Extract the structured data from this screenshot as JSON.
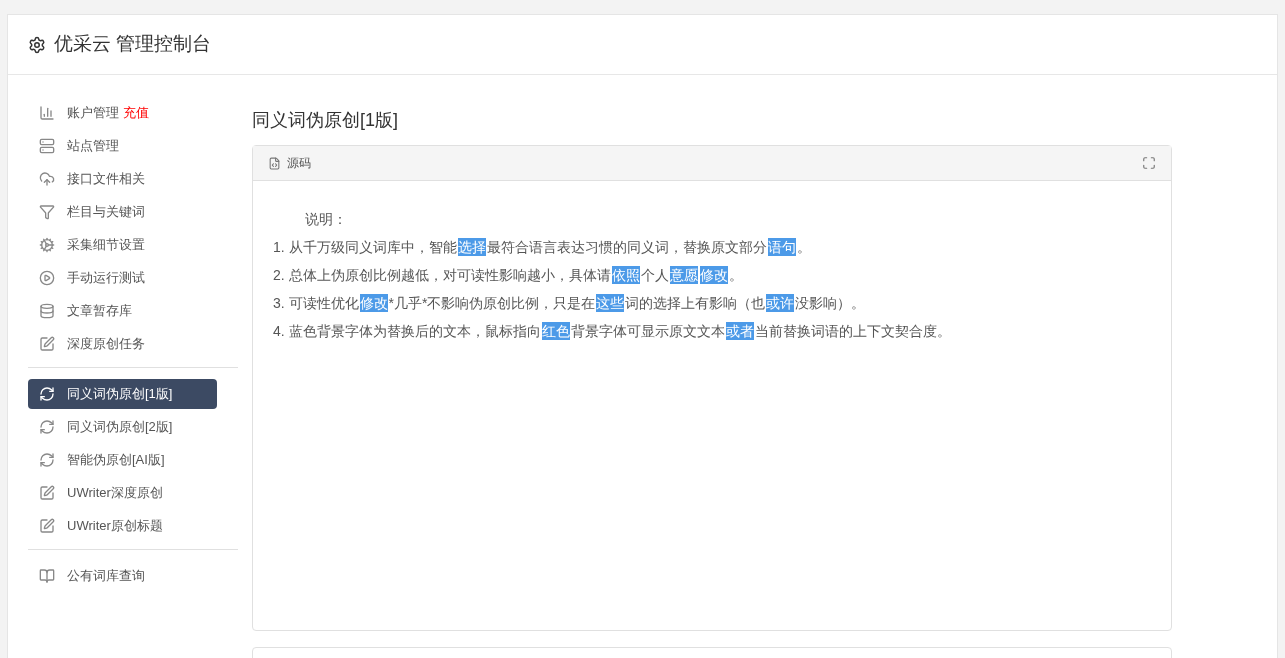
{
  "header": {
    "title": "优采云 管理控制台"
  },
  "sidebar": {
    "groups": [
      {
        "items": [
          {
            "label": "账户管理",
            "badge": "充值",
            "selected": false
          },
          {
            "label": "站点管理",
            "selected": false
          },
          {
            "label": "接口文件相关",
            "selected": false
          },
          {
            "label": "栏目与关键词",
            "selected": false
          },
          {
            "label": "采集细节设置",
            "selected": false
          },
          {
            "label": "手动运行测试",
            "selected": false
          },
          {
            "label": "文章暂存库",
            "selected": false
          },
          {
            "label": "深度原创任务",
            "selected": false
          }
        ]
      },
      {
        "items": [
          {
            "label": "同义词伪原创[1版]",
            "selected": true
          },
          {
            "label": "同义词伪原创[2版]",
            "selected": false
          },
          {
            "label": "智能伪原创[AI版]",
            "selected": false
          },
          {
            "label": "UWriter深度原创",
            "selected": false
          },
          {
            "label": "UWriter原创标题",
            "selected": false
          }
        ]
      },
      {
        "items": [
          {
            "label": "公有词库查询",
            "selected": false
          }
        ]
      }
    ]
  },
  "main": {
    "title": "同义词伪原创[1版]",
    "panel": {
      "title": "源码",
      "heading": "说明：",
      "lines": [
        [
          {
            "text": "1. 从千万级同义词库中，智能",
            "highlighted": false
          },
          {
            "text": "选择",
            "highlighted": true
          },
          {
            "text": "最符合语言表达习惯的同义词，替换原文部分",
            "highlighted": false
          },
          {
            "text": "语句",
            "highlighted": true
          },
          {
            "text": "。",
            "highlighted": false
          }
        ],
        [
          {
            "text": "2. 总体上伪原创比例越低，对可读性影响越小，具体请",
            "highlighted": false
          },
          {
            "text": "依照",
            "highlighted": true
          },
          {
            "text": "个人",
            "highlighted": false
          },
          {
            "text": "意愿",
            "highlighted": true
          },
          {
            "text": "修改",
            "highlighted": true
          },
          {
            "text": "。",
            "highlighted": false
          }
        ],
        [
          {
            "text": "3. 可读性优化",
            "highlighted": false
          },
          {
            "text": "修改",
            "highlighted": true
          },
          {
            "text": "*几乎*不影响伪原创比例，只是在",
            "highlighted": false
          },
          {
            "text": "这些",
            "highlighted": true
          },
          {
            "text": "词的选择上有影响（也",
            "highlighted": false
          },
          {
            "text": "或许",
            "highlighted": true
          },
          {
            "text": "没影响）。",
            "highlighted": false
          }
        ],
        [
          {
            "text": "4. 蓝色背景字体为替换后的文本，鼠标指向",
            "highlighted": false
          },
          {
            "text": "红色",
            "highlighted": true
          },
          {
            "text": "背景字体可显示原文文本",
            "highlighted": false
          },
          {
            "text": "或者",
            "highlighted": true
          },
          {
            "text": "当前替换词语的上下文契合度。",
            "highlighted": false
          }
        ]
      ]
    }
  }
}
